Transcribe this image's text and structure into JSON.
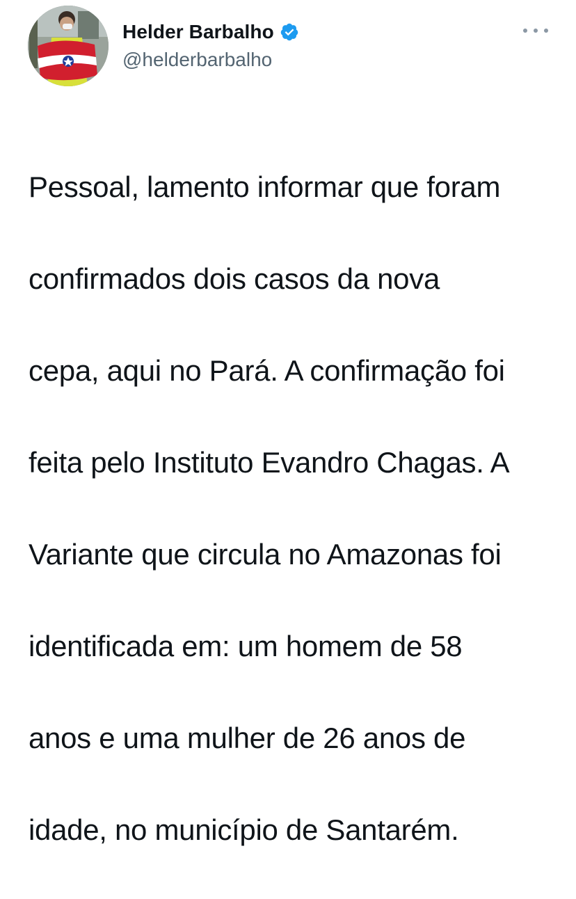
{
  "author": {
    "display_name": "Helder Barbalho",
    "handle": "@helderbarbalho",
    "verified": true,
    "avatar_icon": "profile-photo-with-para-flag",
    "verified_icon": "verified-badge-icon",
    "verified_color": "#1d9bf0"
  },
  "menu": {
    "icon": "more-options-icon"
  },
  "tweet": {
    "lines": [
      "Pessoal, lamento informar que foram",
      "confirmados dois casos da nova",
      "cepa, aqui no Pará. A confirmação foi",
      "feita pelo Instituto Evandro Chagas. A",
      "Variante que circula no Amazonas foi",
      "identificada em: um homem de 58",
      "anos e uma mulher de 26 anos de",
      "idade, no município de Santarém."
    ]
  },
  "colors": {
    "text": "#0f1419",
    "secondary_text": "#536471",
    "background": "#ffffff"
  }
}
